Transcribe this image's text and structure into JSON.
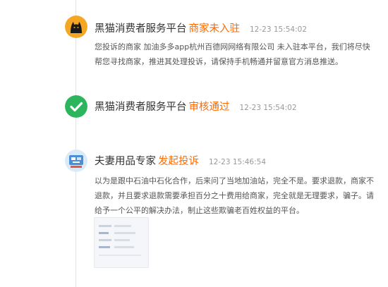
{
  "entries": [
    {
      "avatar": "black-cat-icon",
      "name": "黑猫消费者服务平台",
      "action": "商家未入驻",
      "time": "12-23 15:54:02",
      "body": "您投诉的商家 加油多多app杭州百德网网络有限公司 未入驻本平台，我们将尽快帮您寻找商家，推进其处理投诉，请保持手机畅通并留意官方消息推送。"
    },
    {
      "avatar": "check-icon",
      "name": "黑猫消费者服务平台",
      "action": "审核通过",
      "time": "12-23 15:54:02"
    },
    {
      "avatar": "user-avatar",
      "name": "夫妻用品专家",
      "action": "发起投诉",
      "time": "12-23 15:46:54",
      "body": "以为是跟中石油中石化合作，后来问了当地加油站，完全不是。要求退款，商家不退款，并且要求退款需要承担百分之十费用给商家，完全就是无理要求，骗子。请给予一个公平的解决办法，制止这些欺骗老百姓权益的平台。",
      "attachment": "screenshot-thumbnail"
    }
  ],
  "colors": {
    "action": "#ff6a00",
    "time": "#999999",
    "check_green": "#2db55d",
    "cat_yellow": "#f5a623"
  }
}
